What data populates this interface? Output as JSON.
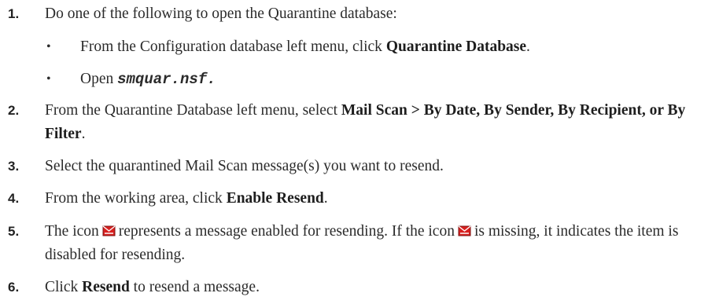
{
  "steps": [
    {
      "number": "1.",
      "text": "Do one of the following to open the Quarantine database:",
      "bullets": [
        {
          "marker": "•",
          "prefix": "From the Configuration database left menu, click ",
          "bold": "Quarantine Database",
          "suffix": "."
        },
        {
          "marker": "•",
          "prefix": "Open ",
          "code": "smquar.nsf",
          "suffix": "."
        }
      ]
    },
    {
      "number": "2.",
      "prefix": "From the Quarantine Database left menu, select ",
      "bold": "Mail Scan > By Date, By Sender, By Recipient, or By Filter",
      "suffix": "."
    },
    {
      "number": "3.",
      "text": "Select the quarantined Mail Scan message(s) you want to resend."
    },
    {
      "number": "4.",
      "prefix": "From the working area, click ",
      "bold": "Enable Resend",
      "suffix": "."
    },
    {
      "number": "5.",
      "part1": "The icon",
      "part2": "represents a message enabled for resending. If the icon",
      "part3": "is missing, it indicates the item is disabled for resending.",
      "icon": "resend-mail-icon",
      "icon_color": "#d8201f"
    },
    {
      "number": "6.",
      "prefix": "Click ",
      "bold": "Resend",
      "suffix": " to resend a message."
    }
  ]
}
